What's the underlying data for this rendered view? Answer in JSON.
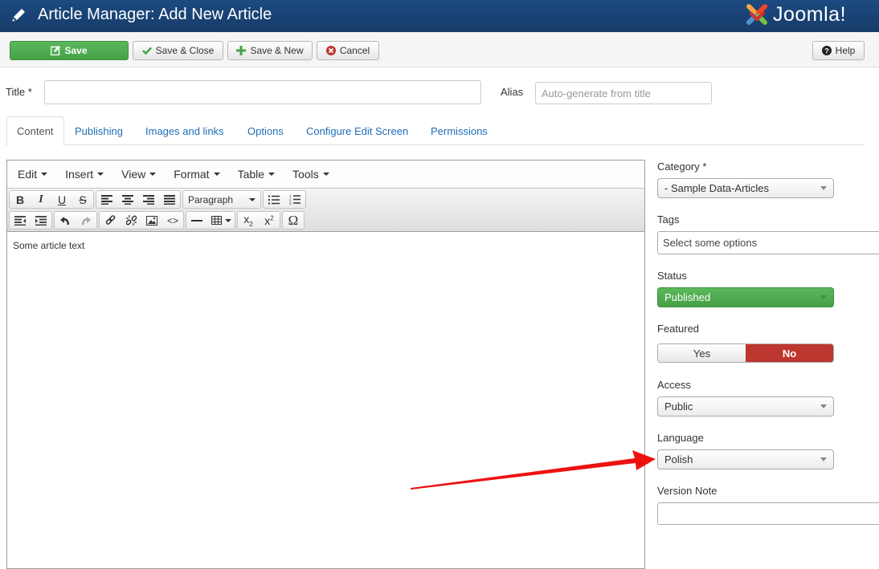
{
  "header": {
    "title": "Article Manager: Add New Article",
    "brand": "Joomla!"
  },
  "toolbar": {
    "save_label": "Save",
    "save_close_label": "Save & Close",
    "save_new_label": "Save & New",
    "cancel_label": "Cancel",
    "help_label": "Help"
  },
  "form": {
    "title_label": "Title *",
    "title_value": "",
    "alias_label": "Alias",
    "alias_placeholder": "Auto-generate from title"
  },
  "tabs": [
    {
      "label": "Content",
      "active": true
    },
    {
      "label": "Publishing"
    },
    {
      "label": "Images and links"
    },
    {
      "label": "Options"
    },
    {
      "label": "Configure Edit Screen"
    },
    {
      "label": "Permissions"
    }
  ],
  "editor": {
    "menus": [
      "Edit",
      "Insert",
      "View",
      "Format",
      "Table",
      "Tools"
    ],
    "format_select": "Paragraph",
    "content": "Some article text"
  },
  "sidebar": {
    "category": {
      "label": "Category *",
      "value": "- Sample Data-Articles"
    },
    "tags": {
      "label": "Tags",
      "placeholder": "Select some options"
    },
    "status": {
      "label": "Status",
      "value": "Published"
    },
    "featured": {
      "label": "Featured",
      "yes": "Yes",
      "no": "No",
      "selected": "No"
    },
    "access": {
      "label": "Access",
      "value": "Public"
    },
    "language": {
      "label": "Language",
      "value": "Polish"
    },
    "version_note": {
      "label": "Version Note",
      "value": ""
    }
  },
  "annotation": {
    "type": "arrow",
    "color": "#ee1111",
    "points_to": "language-select"
  }
}
